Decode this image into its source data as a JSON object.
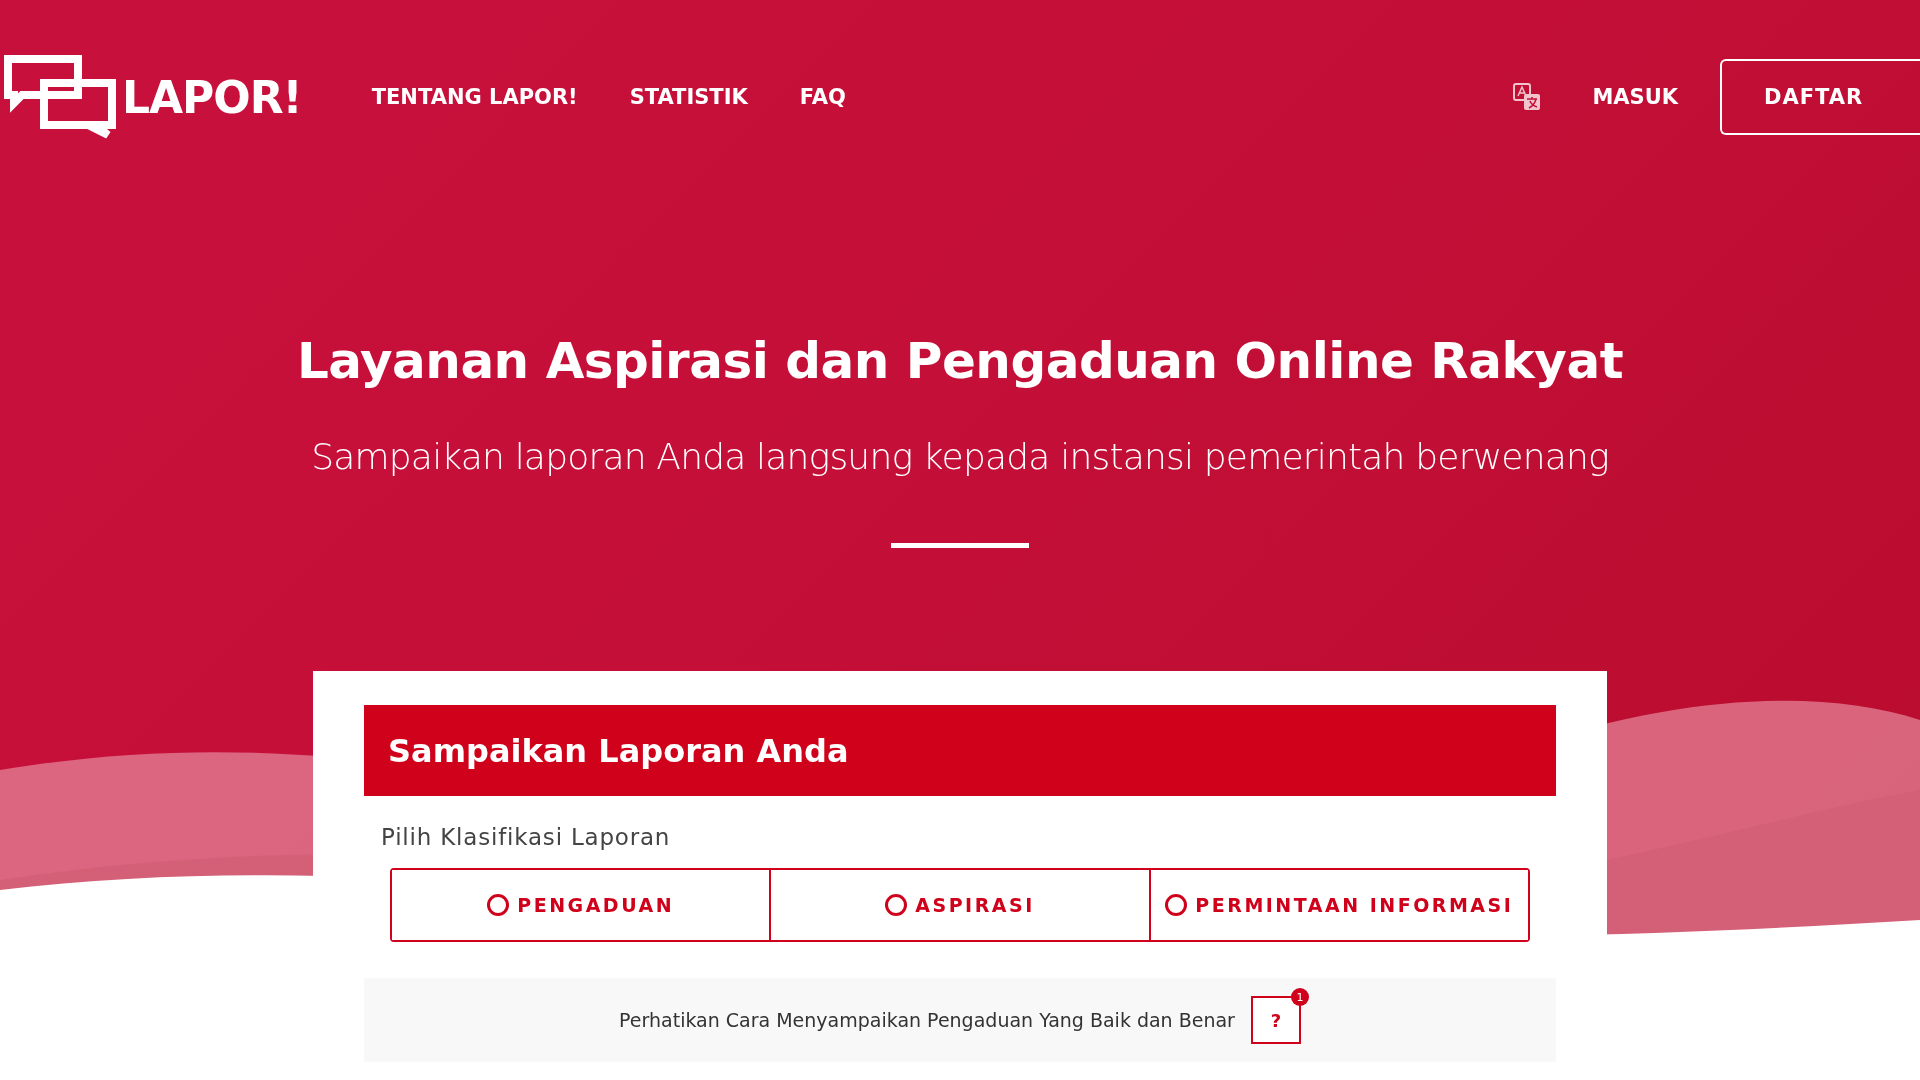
{
  "nav": {
    "logo": "LAPOR!",
    "links": [
      "TENTANG LAPOR!",
      "STATISTIK",
      "FAQ"
    ],
    "login": "MASUK",
    "register": "DAFTAR"
  },
  "hero": {
    "title": "Layanan Aspirasi dan Pengaduan Online Rakyat",
    "subtitle": "Sampaikan laporan Anda langsung kepada instansi pemerintah berwenang"
  },
  "form": {
    "title": "Sampaikan Laporan Anda",
    "classification_label": "Pilih Klasifikasi Laporan",
    "options": [
      {
        "label": "PENGADUAN",
        "selected": false
      },
      {
        "label": "ASPIRASI",
        "selected": false
      },
      {
        "label": "PERMINTAAN INFORMASI",
        "selected": false
      }
    ],
    "notice": "Perhatikan Cara Menyampaikan Pengaduan Yang Baik dan Benar",
    "help_button": "?",
    "help_badge": "1"
  }
}
